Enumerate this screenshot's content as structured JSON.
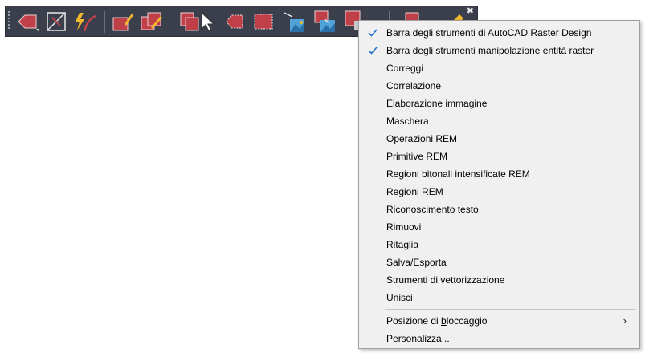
{
  "toolbar": {
    "close_glyph": "✖",
    "buttons": [
      {
        "name": "insert-image-icon"
      },
      {
        "name": "image-frame-icon"
      },
      {
        "name": "correlate-icon"
      },
      {
        "name": "rubbersheet-icon"
      },
      {
        "name": "pencil-edit-icon"
      },
      {
        "name": "remove-region-icon"
      },
      {
        "name": "select-arrow-icon"
      },
      {
        "name": "polygon-region-icon"
      },
      {
        "name": "rectangle-region-icon"
      },
      {
        "name": "image-arrow-icon"
      },
      {
        "name": "image-export-icon"
      },
      {
        "name": "image-settings-icon"
      },
      {
        "name": "merge-icon"
      },
      {
        "name": "vectorize-icon"
      }
    ]
  },
  "menu": {
    "items": [
      {
        "label": "Barra degli strumenti di AutoCAD Raster Design",
        "checked": true
      },
      {
        "label": "Barra degli strumenti manipolazione entità raster",
        "checked": true
      },
      {
        "label": "Correggi",
        "checked": false
      },
      {
        "label": "Correlazione",
        "checked": false
      },
      {
        "label": "Elaborazione immagine",
        "checked": false
      },
      {
        "label": "Maschera",
        "checked": false
      },
      {
        "label": "Operazioni REM",
        "checked": false
      },
      {
        "label": "Primitive REM",
        "checked": false
      },
      {
        "label": "Regioni bitonali intensificate REM",
        "checked": false
      },
      {
        "label": "Regioni REM",
        "checked": false
      },
      {
        "label": "Riconoscimento testo",
        "checked": false
      },
      {
        "label": "Rimuovi",
        "checked": false
      },
      {
        "label": "Ritaglia",
        "checked": false
      },
      {
        "label": "Salva/Esporta",
        "checked": false
      },
      {
        "label": "Strumenti di vettorizzazione",
        "checked": false
      },
      {
        "label": "Unisci",
        "checked": false
      }
    ],
    "docking": {
      "pre": "Posizione di ",
      "accel": "b",
      "post": "loccaggio",
      "arrow": "›"
    },
    "customize": {
      "accel": "P",
      "post": "ersonalizza..."
    }
  },
  "colors": {
    "toolbar_bg": "#3a3f4b",
    "menu_bg": "#f0f0f0",
    "check": "#1e6fd0",
    "icon_red": "#c0404a",
    "icon_yellow": "#f3b82b",
    "icon_blue": "#4fa3d9"
  }
}
